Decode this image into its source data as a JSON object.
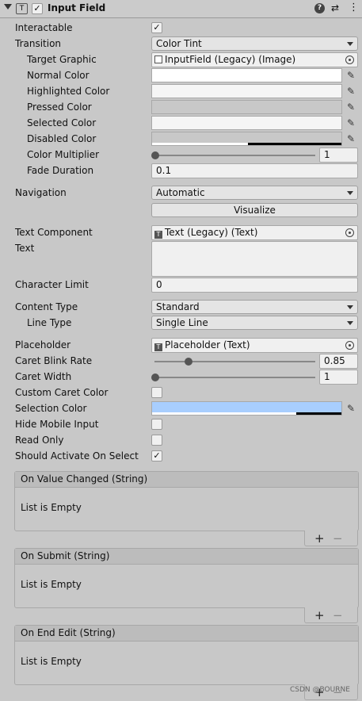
{
  "header": {
    "title": "Input Field",
    "checked": true
  },
  "rows": {
    "interactable": "Interactable",
    "transition": {
      "label": "Transition",
      "value": "Color Tint"
    },
    "target_graphic": {
      "label": "Target Graphic",
      "value": "InputField (Legacy) (Image)"
    },
    "normal_color": {
      "label": "Normal Color"
    },
    "highlighted_color": {
      "label": "Highlighted Color"
    },
    "pressed_color": {
      "label": "Pressed Color"
    },
    "selected_color": {
      "label": "Selected Color"
    },
    "disabled_color": {
      "label": "Disabled Color"
    },
    "color_multiplier": {
      "label": "Color Multiplier",
      "value": "1",
      "level": 0
    },
    "fade_duration": {
      "label": "Fade Duration",
      "value": "0.1"
    },
    "navigation": {
      "label": "Navigation",
      "value": "Automatic"
    },
    "visualize": "Visualize",
    "text_component": {
      "label": "Text Component",
      "value": "Text (Legacy) (Text)"
    },
    "text": {
      "label": "Text",
      "value": ""
    },
    "character_limit": {
      "label": "Character Limit",
      "value": "0"
    },
    "content_type": {
      "label": "Content Type",
      "value": "Standard"
    },
    "line_type": {
      "label": "Line Type",
      "value": "Single Line"
    },
    "placeholder": {
      "label": "Placeholder",
      "value": "Placeholder (Text)"
    },
    "caret_blink_rate": {
      "label": "Caret Blink Rate",
      "value": "0.85",
      "level": 0.21
    },
    "caret_width": {
      "label": "Caret Width",
      "value": "1",
      "level": 0
    },
    "custom_caret_color": {
      "label": "Custom Caret Color",
      "checked": false
    },
    "selection_color": {
      "label": "Selection Color",
      "color": "#a8cefe"
    },
    "hide_mobile_input": {
      "label": "Hide Mobile Input",
      "checked": false
    },
    "read_only": {
      "label": "Read Only",
      "checked": false
    },
    "should_activate": {
      "label": "Should Activate On Select",
      "checked": true
    }
  },
  "events": [
    {
      "title": "On Value Changed (String)",
      "body": "List is Empty"
    },
    {
      "title": "On Submit (String)",
      "body": "List is Empty"
    },
    {
      "title": "On End Edit (String)",
      "body": "List is Empty"
    }
  ],
  "watermark": "CSDN @BOURNE",
  "colors": {
    "selection": "#a8cefe",
    "panel": "#c8c8c8"
  }
}
